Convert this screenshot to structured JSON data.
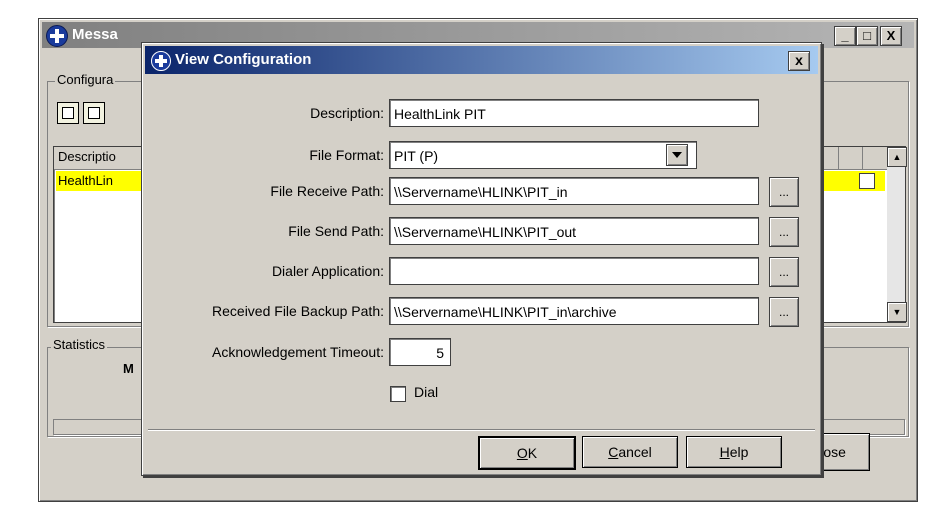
{
  "parent_window": {
    "title": "Messa",
    "controls": {
      "minimize": "_",
      "maximize": "□",
      "close": "X"
    },
    "config_group_label": "Configura",
    "list": {
      "header_description": "Descriptio",
      "row_description": "HealthLin"
    },
    "statistics_label": "Statistics",
    "statistics_value": "M",
    "close_button": {
      "mnemonic": "C",
      "rest": "lose"
    }
  },
  "dialog": {
    "title": "View Configuration",
    "close_glyph": "x",
    "fields": {
      "description": {
        "label": "Description:",
        "value": "HealthLink PIT"
      },
      "file_format": {
        "label": "File Format:",
        "value": "PIT (P)"
      },
      "file_receive_path": {
        "label": "File Receive Path:",
        "value": "\\\\Servername\\HLINK\\PIT_in"
      },
      "file_send_path": {
        "label": "File Send Path:",
        "value": "\\\\Servername\\HLINK\\PIT_out"
      },
      "dialer_application": {
        "label": "Dialer Application:",
        "value": ""
      },
      "received_file_backup_path": {
        "label": "Received File Backup Path:",
        "value": "\\\\Servername\\HLINK\\PIT_in\\archive"
      },
      "acknowledgement_timeout": {
        "label": "Acknowledgement Timeout:",
        "value": "5"
      }
    },
    "browse_label": "...",
    "dial_checkbox": {
      "label": "Dial",
      "checked": false
    },
    "buttons": {
      "ok": {
        "mnemonic": "O",
        "rest": "K"
      },
      "cancel": {
        "mnemonic": "C",
        "rest": "ancel"
      },
      "help": {
        "mnemonic": "H",
        "rest": "elp"
      }
    }
  },
  "colors": {
    "dialog_title_gradient_start": "#0a246a",
    "dialog_title_gradient_end": "#a6caf0",
    "window_face": "#d4d0c8",
    "selected_row": "#ffff00"
  }
}
